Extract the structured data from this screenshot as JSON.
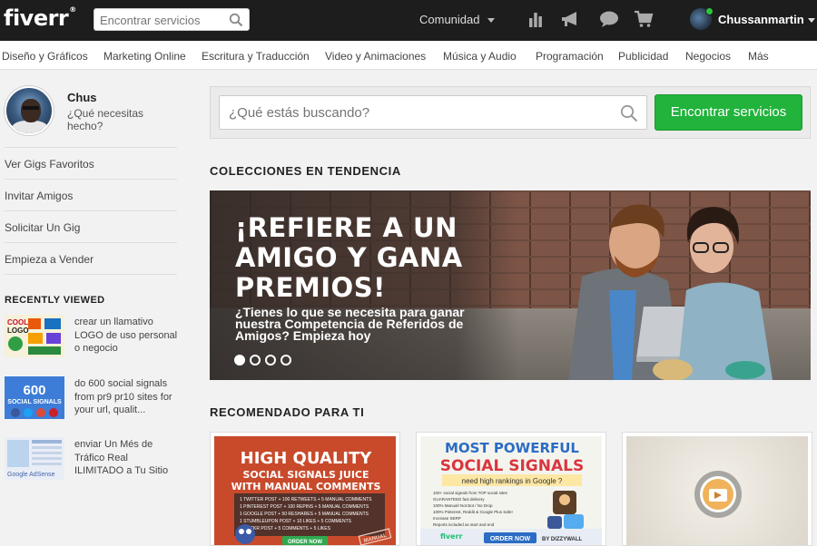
{
  "header": {
    "logo": "fiverr",
    "logo_mark": "®",
    "search_placeholder": "Encontrar servicios",
    "community_label": "Comunidad",
    "username": "Chussanmartin"
  },
  "categories": [
    "Diseño y Gráficos",
    "Marketing Online",
    "Escritura y Traducción",
    "Video y Animaciones",
    "Música y Audio",
    "Programación",
    "Publicidad",
    "Negocios",
    "Más"
  ],
  "sidebar": {
    "profile_name": "Chus",
    "profile_question": "¿Qué necesitas hecho?",
    "links": [
      "Ver Gigs Favoritos",
      "Invitar Amigos",
      "Solicitar Un Gig",
      "Empieza a Vender"
    ],
    "recently_viewed_title": "RECENTLY VIEWED",
    "recent": [
      {
        "text": "crear un llamativo LOGO de uso personal o negocio",
        "thumb_text": [
          "COOL",
          "LOGO"
        ]
      },
      {
        "text": "do 600 social signals from pr9 pr10 sites for your url, qualit...",
        "thumb_text": [
          "600",
          "SOCIAL SIGNALS"
        ]
      },
      {
        "text": "enviar Un Més de Tráfico Real ILIMITADO a Tu Sitio",
        "thumb_text": [
          "Google AdSense"
        ]
      }
    ]
  },
  "main": {
    "search_placeholder": "¿Qué estás buscando?",
    "search_button": "Encontrar servicios",
    "trending_title": "COLECCIONES EN TENDENCIA",
    "banner_headline": "¡REFIERE A UN AMIGO Y GANA PREMIOS!",
    "banner_sub": "¿Tienes lo que se necesita para ganar nuestra Competencia de Referidos de Amigos? Empieza hoy",
    "banner_slides": 4,
    "banner_active_slide": 1,
    "recommended_title": "RECOMENDADO PARA TI",
    "cards": [
      {
        "line1": "HIGH QUALITY",
        "line2": "SOCIAL SIGNALS JUICE",
        "line3": "WITH MANUAL COMMENTS",
        "bullets": [
          "1 TWITTER POST + 100 RETWEETS + 5 MANUAL COMMENTS",
          "1 PINTEREST POST + 100 REPINS + 5 MANUAL COMMENTS",
          "1 GOOGLE POST + 50 RESHARES + 5 MANUAL COMMENTS",
          "1 STUMBLEUPON POST + 10 LIKES + 5 COMMENTS",
          "1 FLICKR POST + 5 COMMENTS + 5 LIKES"
        ],
        "button": "ORDER NOW",
        "stamp": "MANUAL"
      },
      {
        "line1": "MOST POWERFUL",
        "line2": "SOCIAL SIGNALS",
        "line3": "need high rankings in Google ?",
        "bullets": [
          "100+ social signals from TOP social sites",
          "GUARANTEED fast delivery",
          "100% Manual! Not Bot / No Drop",
          "100% Pinterest, Reddit & Google Plus Safe!",
          "Increase SERP",
          "Reports included as start and end"
        ],
        "button": "ORDER NOW",
        "byline": "BY DIZZYWALL",
        "brand": "fiverr"
      }
    ]
  },
  "colors": {
    "topbar": "#1d1d1d",
    "primary_button": "#21b33b",
    "online_dot": "#2fc43c"
  }
}
